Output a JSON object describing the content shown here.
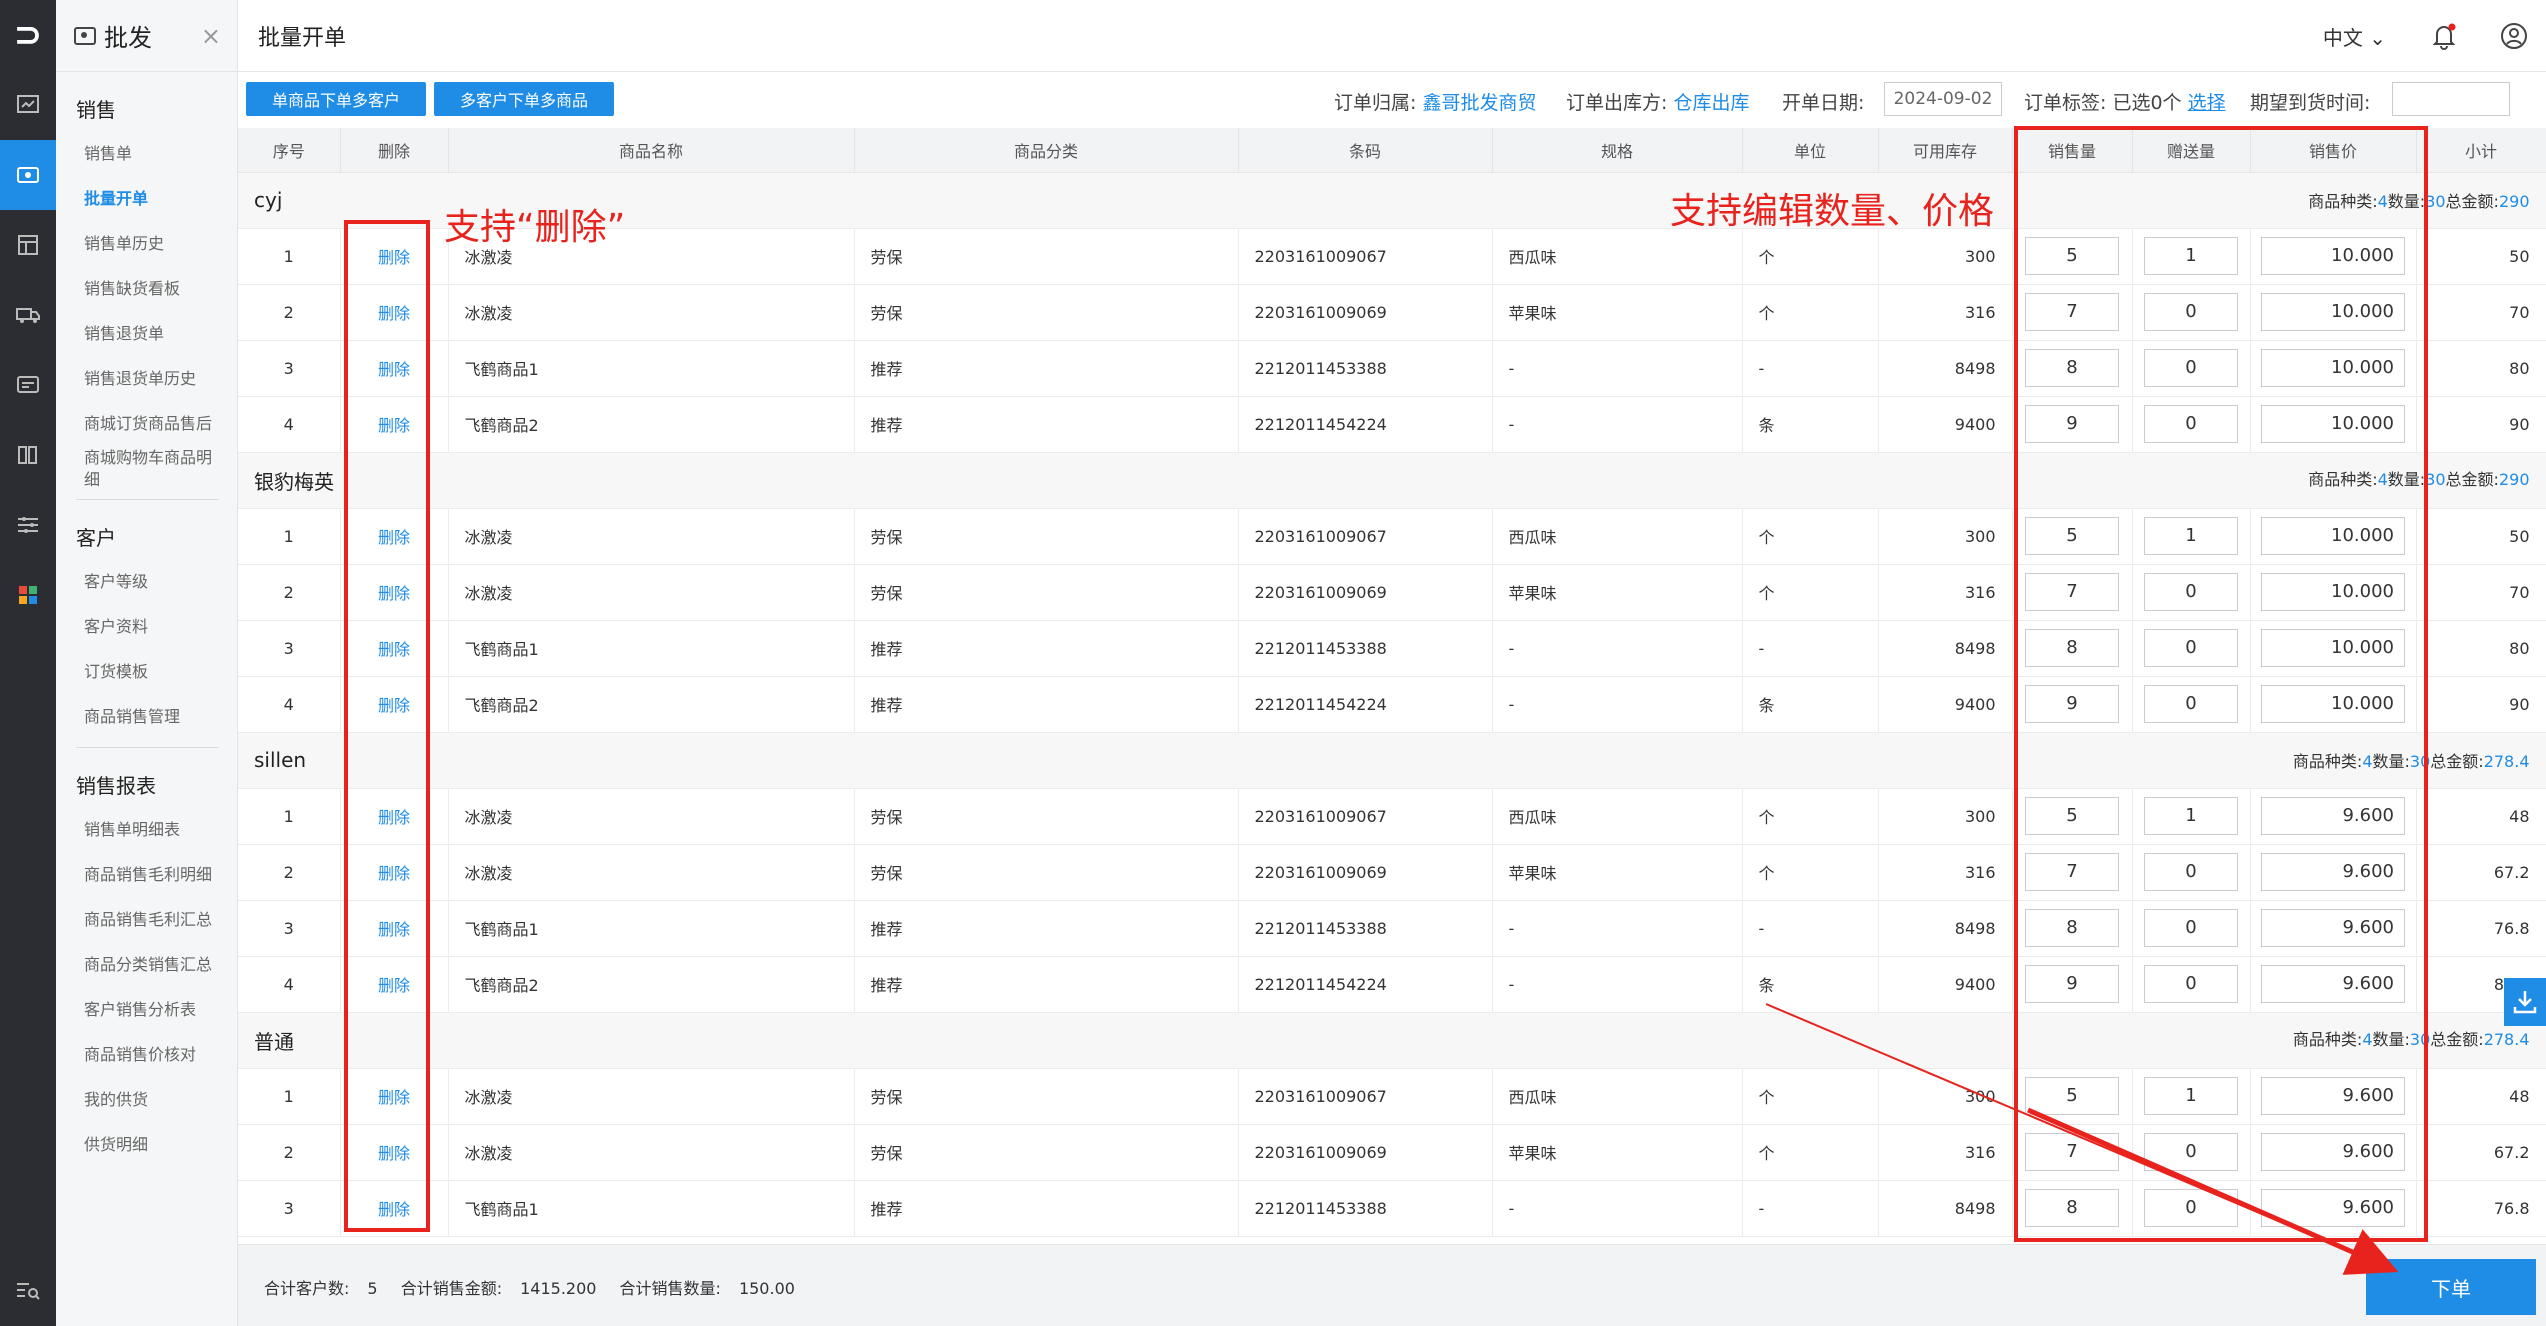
{
  "app": {
    "logo": "⊃",
    "rail_icons": [
      "dashboard-icon",
      "sales-icon",
      "product-icon",
      "delivery-icon",
      "finance-icon",
      "report-icon",
      "settings-icon",
      "apps-icon"
    ],
    "bottom_icon": "search-list-icon"
  },
  "subnav": {
    "title": "批发",
    "close": "×",
    "groups": [
      {
        "label": "销售",
        "items": [
          "销售单",
          "批量开单",
          "销售单历史",
          "销售缺货看板",
          "销售退货单",
          "销售退货单历史",
          "商城订货商品售后",
          "商城购物车商品明细"
        ]
      },
      {
        "label": "客户",
        "items": [
          "客户等级",
          "客户资料",
          "订货模板",
          "商品销售管理"
        ]
      },
      {
        "label": "销售报表",
        "items": [
          "销售单明细表",
          "商品销售毛利明细",
          "商品销售毛利汇总",
          "商品分类销售汇总",
          "客户销售分析表",
          "商品销售价核对",
          "我的供货",
          "供货明细"
        ]
      }
    ],
    "active": "批量开单"
  },
  "topbar": {
    "title": "批量开单",
    "lang": "中文 ⌄"
  },
  "toolbar": {
    "btn_single": "单商品下单多客户",
    "btn_multi": "多客户下单多商品",
    "owner_label": "订单归属:",
    "owner_value": "鑫哥批发商贸",
    "warehouse_label": "订单出库方:",
    "warehouse_value": "仓库出库",
    "date_label": "开单日期:",
    "date_value": "2024-09-02",
    "tag_label": "订单标签:",
    "tag_value": "已选0个",
    "tag_link": "选择",
    "expected_label": "期望到货时间:"
  },
  "table": {
    "headers": [
      "序号",
      "删除",
      "商品名称",
      "商品分类",
      "条码",
      "规格",
      "单位",
      "可用库存",
      "销售量",
      "赠送量",
      "销售价",
      "小计"
    ],
    "groups": [
      {
        "name": "cyj",
        "summary": {
          "kinds_label": "商品种类:",
          "kinds": "4",
          "qty_label": "数量:",
          "qty": "30",
          "amount_label": "总金额:",
          "amount": "290"
        },
        "rows": [
          {
            "no": "1",
            "del": "删除",
            "name": "冰激凌",
            "cat": "劳保",
            "barcode": "2203161009067",
            "spec": "西瓜味",
            "unit": "个",
            "stock": "300",
            "qty": "5",
            "gift": "1",
            "price": "10.000",
            "subtotal": "50"
          },
          {
            "no": "2",
            "del": "删除",
            "name": "冰激凌",
            "cat": "劳保",
            "barcode": "2203161009069",
            "spec": "苹果味",
            "unit": "个",
            "stock": "316",
            "qty": "7",
            "gift": "0",
            "price": "10.000",
            "subtotal": "70"
          },
          {
            "no": "3",
            "del": "删除",
            "name": "飞鹤商品1",
            "cat": "推荐",
            "barcode": "2212011453388",
            "spec": "-",
            "unit": "-",
            "stock": "8498",
            "qty": "8",
            "gift": "0",
            "price": "10.000",
            "subtotal": "80"
          },
          {
            "no": "4",
            "del": "删除",
            "name": "飞鹤商品2",
            "cat": "推荐",
            "barcode": "2212011454224",
            "spec": "-",
            "unit": "条",
            "stock": "9400",
            "qty": "9",
            "gift": "0",
            "price": "10.000",
            "subtotal": "90"
          }
        ]
      },
      {
        "name": "银豹梅英",
        "summary": {
          "kinds_label": "商品种类:",
          "kinds": "4",
          "qty_label": "数量:",
          "qty": "30",
          "amount_label": "总金额:",
          "amount": "290"
        },
        "rows": [
          {
            "no": "1",
            "del": "删除",
            "name": "冰激凌",
            "cat": "劳保",
            "barcode": "2203161009067",
            "spec": "西瓜味",
            "unit": "个",
            "stock": "300",
            "qty": "5",
            "gift": "1",
            "price": "10.000",
            "subtotal": "50"
          },
          {
            "no": "2",
            "del": "删除",
            "name": "冰激凌",
            "cat": "劳保",
            "barcode": "2203161009069",
            "spec": "苹果味",
            "unit": "个",
            "stock": "316",
            "qty": "7",
            "gift": "0",
            "price": "10.000",
            "subtotal": "70"
          },
          {
            "no": "3",
            "del": "删除",
            "name": "飞鹤商品1",
            "cat": "推荐",
            "barcode": "2212011453388",
            "spec": "-",
            "unit": "-",
            "stock": "8498",
            "qty": "8",
            "gift": "0",
            "price": "10.000",
            "subtotal": "80"
          },
          {
            "no": "4",
            "del": "删除",
            "name": "飞鹤商品2",
            "cat": "推荐",
            "barcode": "2212011454224",
            "spec": "-",
            "unit": "条",
            "stock": "9400",
            "qty": "9",
            "gift": "0",
            "price": "10.000",
            "subtotal": "90"
          }
        ]
      },
      {
        "name": "sillen",
        "summary": {
          "kinds_label": "商品种类:",
          "kinds": "4",
          "qty_label": "数量:",
          "qty": "30",
          "amount_label": "总金额:",
          "amount": "278.4"
        },
        "rows": [
          {
            "no": "1",
            "del": "删除",
            "name": "冰激凌",
            "cat": "劳保",
            "barcode": "2203161009067",
            "spec": "西瓜味",
            "unit": "个",
            "stock": "300",
            "qty": "5",
            "gift": "1",
            "price": "9.600",
            "subtotal": "48"
          },
          {
            "no": "2",
            "del": "删除",
            "name": "冰激凌",
            "cat": "劳保",
            "barcode": "2203161009069",
            "spec": "苹果味",
            "unit": "个",
            "stock": "316",
            "qty": "7",
            "gift": "0",
            "price": "9.600",
            "subtotal": "67.2"
          },
          {
            "no": "3",
            "del": "删除",
            "name": "飞鹤商品1",
            "cat": "推荐",
            "barcode": "2212011453388",
            "spec": "-",
            "unit": "-",
            "stock": "8498",
            "qty": "8",
            "gift": "0",
            "price": "9.600",
            "subtotal": "76.8"
          },
          {
            "no": "4",
            "del": "删除",
            "name": "飞鹤商品2",
            "cat": "推荐",
            "barcode": "2212011454224",
            "spec": "-",
            "unit": "条",
            "stock": "9400",
            "qty": "9",
            "gift": "0",
            "price": "9.600",
            "subtotal": "86.4"
          }
        ]
      },
      {
        "name": "普通",
        "summary": {
          "kinds_label": "商品种类:",
          "kinds": "4",
          "qty_label": "数量:",
          "qty": "30",
          "amount_label": "总金额:",
          "amount": "278.4"
        },
        "rows": [
          {
            "no": "1",
            "del": "删除",
            "name": "冰激凌",
            "cat": "劳保",
            "barcode": "2203161009067",
            "spec": "西瓜味",
            "unit": "个",
            "stock": "300",
            "qty": "5",
            "gift": "1",
            "price": "9.600",
            "subtotal": "48"
          },
          {
            "no": "2",
            "del": "删除",
            "name": "冰激凌",
            "cat": "劳保",
            "barcode": "2203161009069",
            "spec": "苹果味",
            "unit": "个",
            "stock": "316",
            "qty": "7",
            "gift": "0",
            "price": "9.600",
            "subtotal": "67.2"
          },
          {
            "no": "3",
            "del": "删除",
            "name": "飞鹤商品1",
            "cat": "推荐",
            "barcode": "2212011453388",
            "spec": "-",
            "unit": "-",
            "stock": "8498",
            "qty": "8",
            "gift": "0",
            "price": "9.600",
            "subtotal": "76.8"
          }
        ]
      }
    ]
  },
  "footer": {
    "customers_label": "合计客户数:",
    "customers": "5",
    "amount_label": "合计销售金额:",
    "amount": "1415.200",
    "qty_label": "合计销售数量:",
    "qty": "150.00",
    "order_btn": "下单"
  },
  "annotations": {
    "delete_note": "支持“删除”",
    "edit_note": "支持编辑数量、价格",
    "color": "#e8231d"
  },
  "colors": {
    "accent": "#1f8ce6",
    "rail": "#2b2d33"
  }
}
